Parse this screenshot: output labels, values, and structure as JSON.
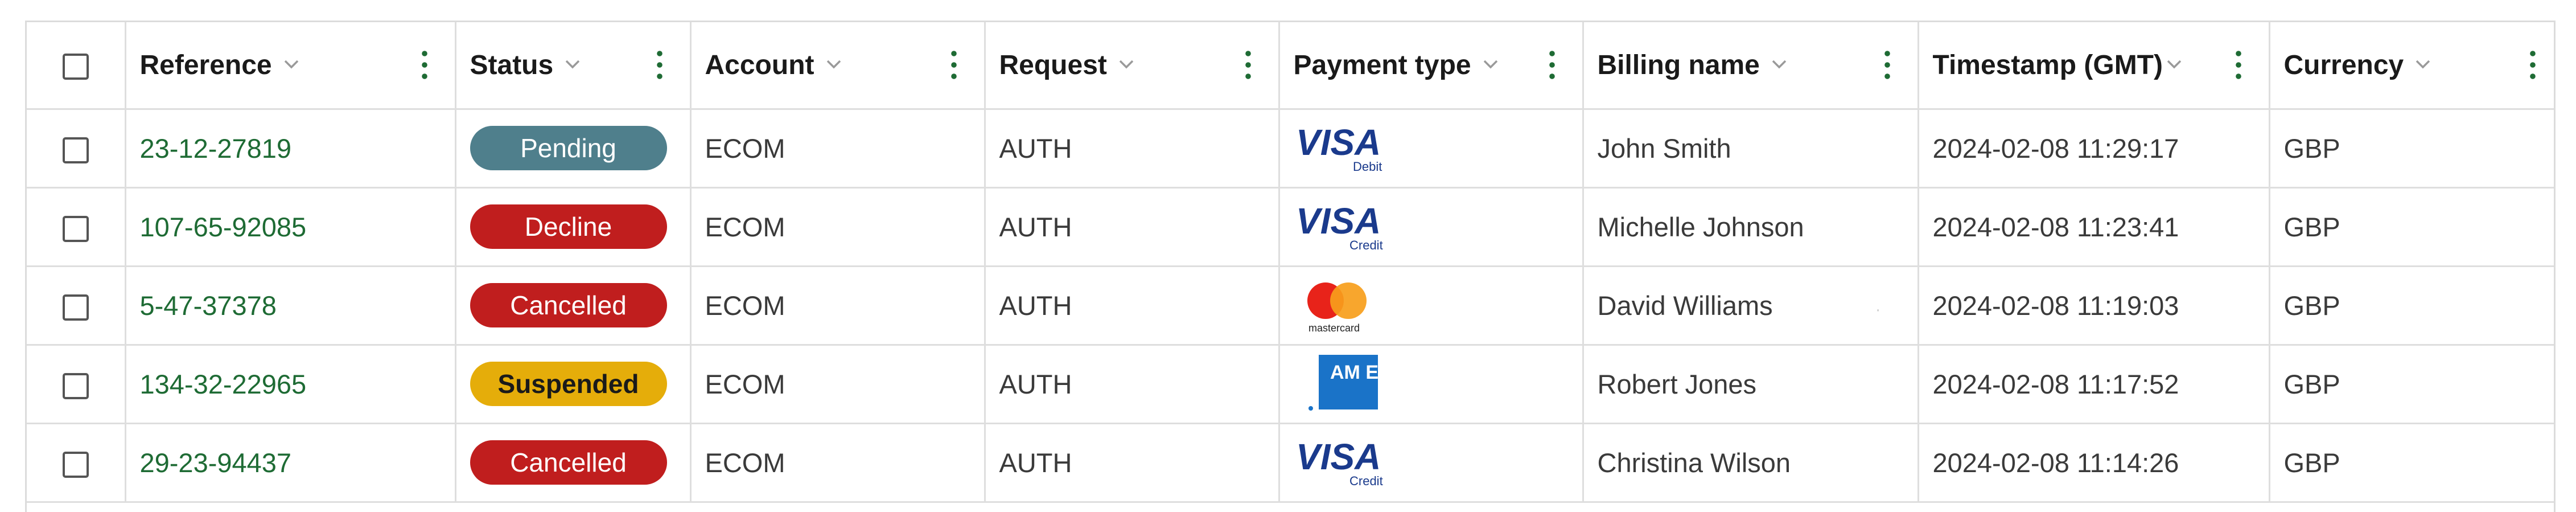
{
  "columns": [
    {
      "key": "reference",
      "label": "Reference"
    },
    {
      "key": "status",
      "label": "Status"
    },
    {
      "key": "account",
      "label": "Account"
    },
    {
      "key": "request",
      "label": "Request"
    },
    {
      "key": "payment_type",
      "label": "Payment type"
    },
    {
      "key": "billing_name",
      "label": "Billing name"
    },
    {
      "key": "timestamp",
      "label": "Timestamp (GMT)"
    },
    {
      "key": "currency",
      "label": "Currency"
    }
  ],
  "status_colors": {
    "Pending": "#4f7f8c",
    "Decline": "#c01e1e",
    "Cancelled": "#c01e1e",
    "Suspended": "#e5ad0a"
  },
  "card_brand_text": {
    "visa": "VISA",
    "debit": "Debit",
    "credit": "Credit",
    "mastercard": "mastercard",
    "amex": "AM EX"
  },
  "rows": [
    {
      "reference": "23-12-27819",
      "status": "Pending",
      "account": "ECOM",
      "request": "AUTH",
      "payment_type": "visa-debit",
      "billing_name": "John Smith",
      "timestamp": "2024-02-08 11:29:17",
      "currency": "GBP"
    },
    {
      "reference": "107-65-92085",
      "status": "Decline",
      "account": "ECOM",
      "request": "AUTH",
      "payment_type": "visa-credit",
      "billing_name": "Michelle Johnson",
      "timestamp": "2024-02-08 11:23:41",
      "currency": "GBP"
    },
    {
      "reference": "5-47-37378",
      "status": "Cancelled",
      "account": "ECOM",
      "request": "AUTH",
      "payment_type": "mastercard",
      "billing_name": "David Williams",
      "timestamp": "2024-02-08 11:19:03",
      "currency": "GBP"
    },
    {
      "reference": "134-32-22965",
      "status": "Suspended",
      "account": "ECOM",
      "request": "AUTH",
      "payment_type": "amex",
      "billing_name": "Robert Jones",
      "timestamp": "2024-02-08 11:17:52",
      "currency": "GBP"
    },
    {
      "reference": "29-23-94437",
      "status": "Cancelled",
      "account": "ECOM",
      "request": "AUTH",
      "payment_type": "visa-credit",
      "billing_name": "Christina Wilson",
      "timestamp": "2024-02-08 11:14:26",
      "currency": "GBP"
    }
  ]
}
